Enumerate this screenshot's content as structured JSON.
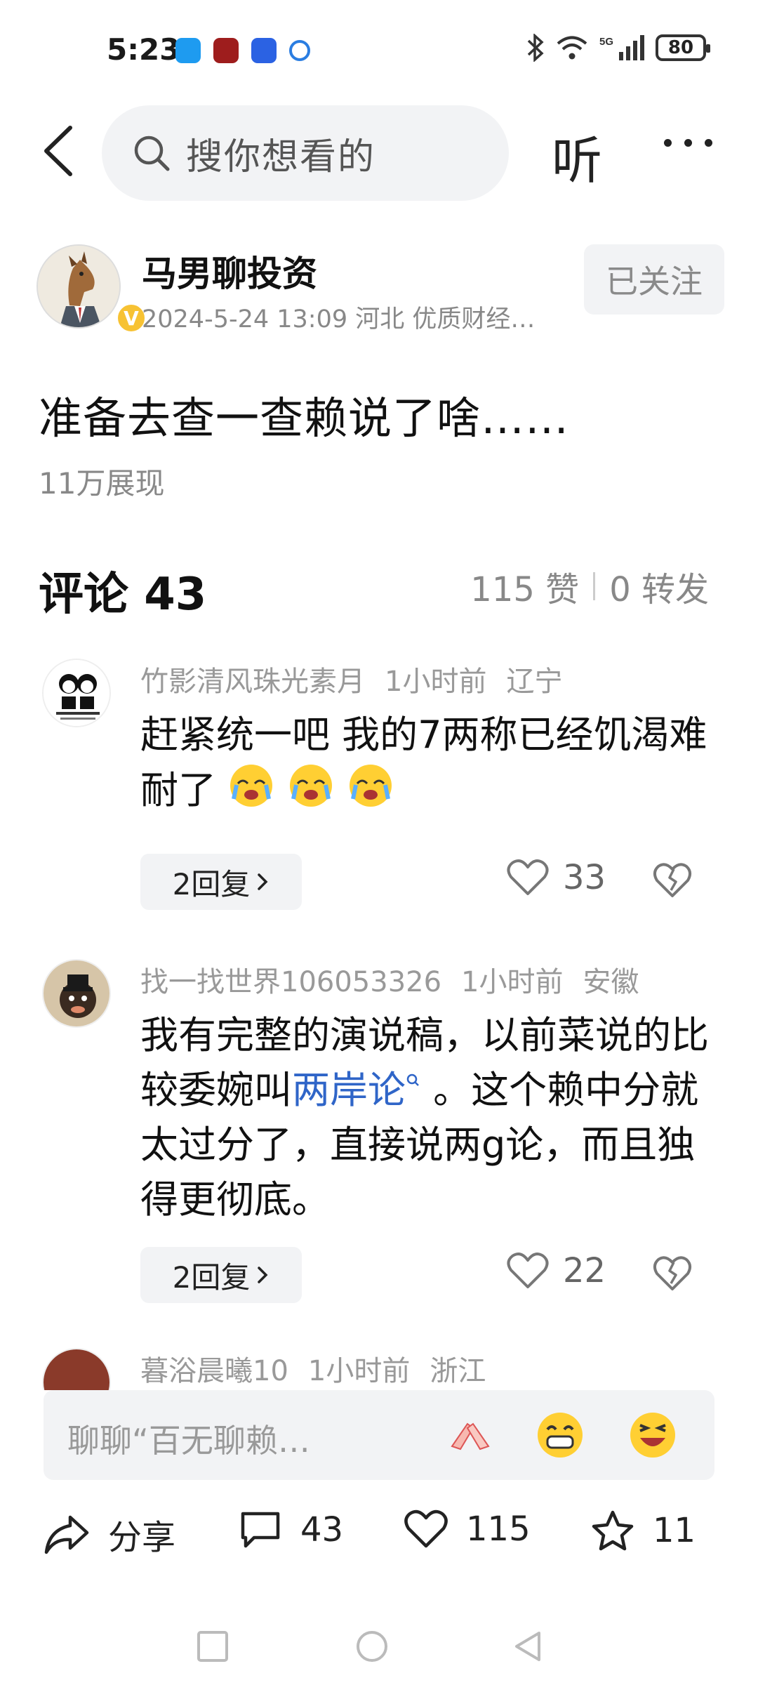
{
  "status_bar": {
    "time": "5:23",
    "battery": "80",
    "network": "5G"
  },
  "nav": {
    "search_placeholder": "搜你想看的",
    "listen_label": "听"
  },
  "author": {
    "name": "马男聊投资",
    "meta": "2024-5-24 13:09 河北 优质财经…",
    "follow_label": "已关注",
    "badge": "V"
  },
  "post": {
    "text": "准备去查一查赖说了啥……",
    "views": "11万展现"
  },
  "comments_header": {
    "title": "评论 43",
    "likes": "115 赞",
    "shares": "0 转发"
  },
  "comments": [
    {
      "user": "竹影清风珠光素月",
      "time": "1小时前",
      "location": "辽宁",
      "text": "赶紧统一吧 我的7两称已经饥渴难耐了",
      "replies_label": "2回复",
      "likes": "33"
    },
    {
      "user": "找一找世界106053326",
      "time": "1小时前",
      "location": "安徽",
      "text_before": "我有完整的演说稿，以前菜说的比较委婉叫",
      "link": "两岸论",
      "text_after": " 。这个赖中分就太过分了，直接说两g论，而且独得更彻底。",
      "replies_label": "2回复",
      "likes": "22"
    },
    {
      "user": "暮浴晨曦10",
      "time": "1小时前",
      "location": "浙江"
    }
  ],
  "input_bar": {
    "placeholder": "聊聊“百无聊赖…"
  },
  "actions": {
    "share_label": "分享",
    "comments_count": "43",
    "likes_count": "115",
    "favorites_count": "11"
  },
  "colors": {
    "link": "#2f65c8",
    "badge": "#f7c233",
    "muted": "#888888",
    "chip_bg": "#f2f3f5"
  }
}
